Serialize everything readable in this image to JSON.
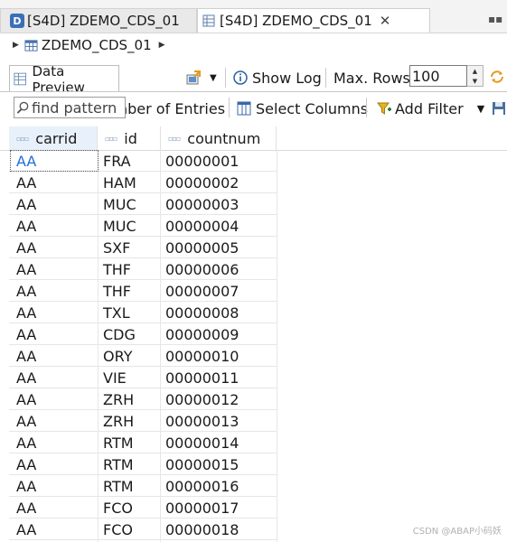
{
  "tabs": [
    {
      "label": "[S4D] ZDEMO_CDS_01",
      "active": false
    },
    {
      "label": "[S4D] ZDEMO_CDS_01",
      "active": true
    }
  ],
  "breadcrumb": {
    "label": "ZDEMO_CDS_01"
  },
  "view_tab": {
    "label": "Data Preview"
  },
  "toolbar": {
    "show_log_label": "Show Log",
    "max_rows_label": "Max. Rows:",
    "max_rows_value": "100"
  },
  "toolbar2": {
    "number_entries_label": "nber of Entries",
    "select_columns_label": "Select Columns",
    "add_filter_label": "Add Filter",
    "find_placeholder": "find pattern"
  },
  "table": {
    "columns": [
      "carrid",
      "id",
      "countnum"
    ],
    "rows": [
      [
        "AA",
        "FRA",
        "00000001"
      ],
      [
        "AA",
        "HAM",
        "00000002"
      ],
      [
        "AA",
        "MUC",
        "00000003"
      ],
      [
        "AA",
        "MUC",
        "00000004"
      ],
      [
        "AA",
        "SXF",
        "00000005"
      ],
      [
        "AA",
        "THF",
        "00000006"
      ],
      [
        "AA",
        "THF",
        "00000007"
      ],
      [
        "AA",
        "TXL",
        "00000008"
      ],
      [
        "AA",
        "CDG",
        "00000009"
      ],
      [
        "AA",
        "ORY",
        "00000010"
      ],
      [
        "AA",
        "VIE",
        "00000011"
      ],
      [
        "AA",
        "ZRH",
        "00000012"
      ],
      [
        "AA",
        "ZRH",
        "00000013"
      ],
      [
        "AA",
        "RTM",
        "00000014"
      ],
      [
        "AA",
        "RTM",
        "00000015"
      ],
      [
        "AA",
        "RTM",
        "00000016"
      ],
      [
        "AA",
        "FCO",
        "00000017"
      ],
      [
        "AA",
        "FCO",
        "00000018"
      ]
    ]
  },
  "watermark": "CSDN @ABAP小码妖",
  "colors": {
    "accent": "#1f6fd1",
    "header_selected": "#e8f1fb"
  }
}
